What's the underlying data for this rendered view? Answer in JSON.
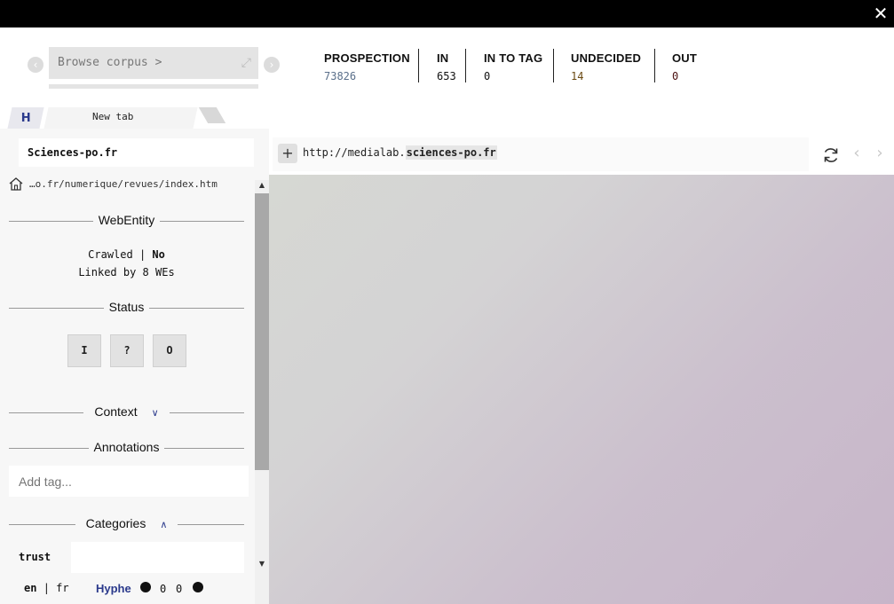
{
  "window": {
    "close_glyph": "✕"
  },
  "nav": {
    "back_icon": "chevron-left-icon",
    "forward_icon": "chevron-right-icon",
    "browse_label": "Browse corpus >",
    "expand_icon": "expand-icon"
  },
  "stats": [
    {
      "label": "PROSPECTION",
      "value": "73826",
      "color": "#5a6f8a"
    },
    {
      "label": "IN",
      "value": "653",
      "color": "#111111"
    },
    {
      "label": "IN TO TAG",
      "value": "0",
      "color": "#111111"
    },
    {
      "label": "UNDECIDED",
      "value": "14",
      "color": "#6b4a12"
    },
    {
      "label": "OUT",
      "value": "0",
      "color": "#4a1010"
    }
  ],
  "tabs": {
    "home_label": "H",
    "new_tab_label": "New tab"
  },
  "sidebar": {
    "webentity_name": "Sciences-po.fr",
    "page_path": "…o.fr/numerique/revues/index.htm",
    "webentity_heading": "WebEntity",
    "crawled_label": "Crawled |",
    "crawled_value": "No",
    "linked_text": "Linked by 8 WEs",
    "status_heading": "Status",
    "status_buttons": [
      "I",
      "?",
      "O"
    ],
    "context_heading": "Context",
    "annotations_heading": "Annotations",
    "tag_placeholder": "Add tag...",
    "categories_heading": "Categories",
    "category_row_label": "trust",
    "footer": {
      "lang_active": "en",
      "lang_sep": "|",
      "lang_other": "fr",
      "brand": "Hyphe",
      "count_a": "0",
      "count_b": "0"
    }
  },
  "urlbar": {
    "url_prefix": "http://medialab.",
    "url_domain": "sciences-po.fr",
    "reload_icon": "reload-icon"
  },
  "colors": {
    "accent": "#2b3a8c",
    "titlebar": "#000000"
  }
}
